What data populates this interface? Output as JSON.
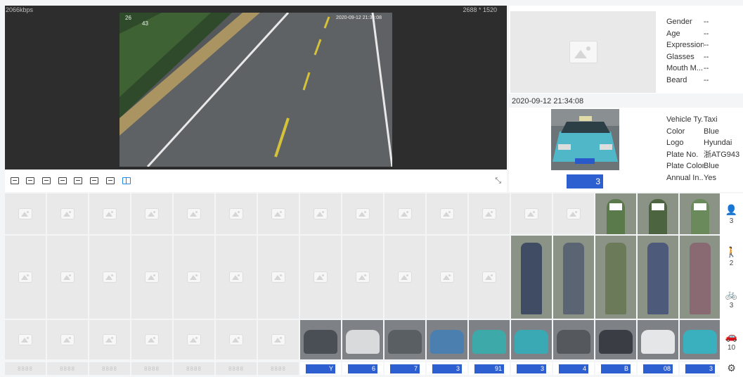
{
  "video": {
    "bitrate": "2066kbps",
    "resolution": "2688 * 1520",
    "overlay_top_left": "26",
    "overlay_top_left_2": "43",
    "overlay_timestamp": "2020-09-12 21:34:08"
  },
  "toolbar": {
    "icons": [
      "mode-1-icon",
      "mode-2-icon",
      "mode-3-icon",
      "mode-4-icon",
      "mode-5-icon",
      "mode-6-icon",
      "mode-7-icon",
      "mode-8-icon"
    ],
    "active_index": 7,
    "expand_glyph": "⤡"
  },
  "face_panel": {
    "attributes": [
      {
        "key": "Gender",
        "value": "--"
      },
      {
        "key": "Age",
        "value": "--"
      },
      {
        "key": "Expression",
        "value": "--"
      },
      {
        "key": "Glasses",
        "value": "--"
      },
      {
        "key": "Mouth M...",
        "value": "--"
      },
      {
        "key": "Beard",
        "value": "--"
      }
    ]
  },
  "vehicle_panel": {
    "datetime": "2020-09-12 21:34:08",
    "plate_suffix": "3",
    "attributes": [
      {
        "key": "Vehicle Ty...",
        "value": "Taxi"
      },
      {
        "key": "Color",
        "value": "Blue"
      },
      {
        "key": "Logo",
        "value": "Hyundai"
      },
      {
        "key": "Plate No.",
        "value": "浙ATG943"
      },
      {
        "key": "Plate Color",
        "value": "Blue"
      },
      {
        "key": "Annual In...",
        "value": "Yes"
      }
    ]
  },
  "grid": {
    "empty_plate_text": "8888",
    "plate_suffixes": [
      "Y",
      "6",
      "7",
      "3",
      "91",
      "3",
      "4",
      "B",
      "08",
      "3"
    ]
  },
  "side_nav": [
    {
      "icon": "person-icon",
      "glyph": "👤",
      "count": "3"
    },
    {
      "icon": "pedestrian-icon",
      "glyph": "🚶",
      "count": "2"
    },
    {
      "icon": "bicycle-icon",
      "glyph": "🚲",
      "count": "3"
    },
    {
      "icon": "car-icon",
      "glyph": "🚗",
      "count": "10"
    },
    {
      "icon": "gear-icon",
      "glyph": "⚙",
      "count": ""
    }
  ],
  "colors": {
    "accent": "#1e88e5",
    "video_bg": "#2d2d2e",
    "placeholder": "#e9e9e9"
  }
}
